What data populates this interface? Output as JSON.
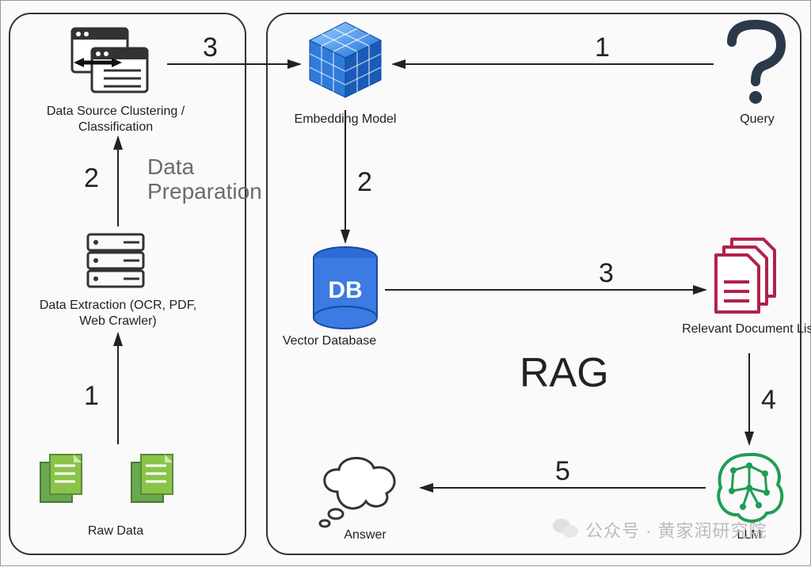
{
  "diagram": {
    "data_prep_section": "Data\nPreparation",
    "rag_title": "RAG",
    "nodes": {
      "raw_data": "Raw Data",
      "data_extraction": "Data Extraction (OCR, PDF, Web Crawler)",
      "clustering": "Data Source Clustering / Classification",
      "embedding": "Embedding Model",
      "query": "Query",
      "vector_db": "Vector Database",
      "doc_list": "Relevant Document List",
      "llm": "LLM",
      "answer": "Answer"
    },
    "edge_labels": {
      "dp_1": "1",
      "dp_2": "2",
      "dp_3": "3",
      "rag_1": "1",
      "rag_2": "2",
      "rag_3": "3",
      "rag_4": "4",
      "rag_5": "5"
    },
    "watermark": "公众号 · 黄家润研究院"
  }
}
